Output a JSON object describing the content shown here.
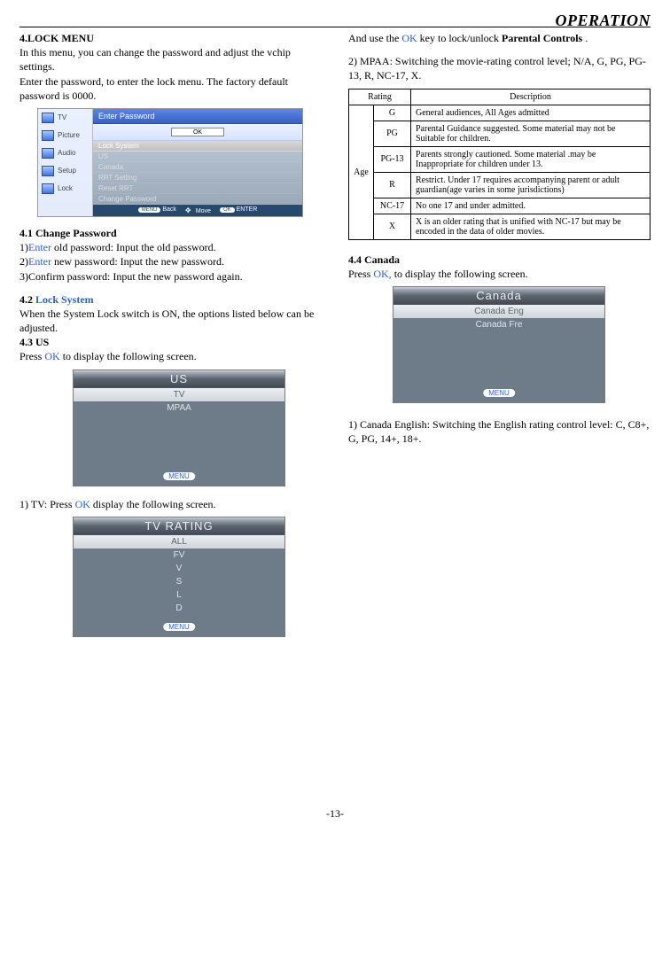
{
  "header": {
    "title": "OPERATION"
  },
  "left": {
    "s4_title": "4.LOCK MENU",
    "s4_p1": "In this menu, you can change the password and adjust the vchip settings.",
    "s4_p2": "Enter the password, to enter the lock menu. The factory default password is 0000.",
    "lockbox": {
      "side": [
        "TV",
        "Picture",
        "Audio",
        "Setup",
        "Lock"
      ],
      "top": "Enter Password",
      "ok": "OK",
      "rows": [
        "Lock System",
        "US",
        "Canada",
        "RRT Setting",
        "Reset RRT",
        "Change Password"
      ],
      "foot_menu": "MENU",
      "foot_back": "Back",
      "foot_move": "Move",
      "foot_ok": "OK",
      "foot_enter": "ENTER"
    },
    "s41_title": "4.1 Change Password",
    "s41_1a": "1)",
    "s41_1b": "Enter",
    "s41_1c": " old password: Input the old password.",
    "s41_2a": "2)",
    "s41_2b": "Enter",
    "s41_2c": " new password: Input the new password.",
    "s41_3": "3)Confirm password: Input the new password again.",
    "s42_title_a": "4.2 ",
    "s42_title_b": "Lock System",
    "s42_p": "When the System Lock switch is ON, the options listed below can be adjusted.",
    "s43_title": "4.3 US",
    "s43_a": "Press ",
    "s43_b": "OK",
    "s43_c": " to display the following screen.",
    "us_panel": {
      "title": "US",
      "row1": "TV",
      "row2": "MPAA",
      "menu": "MENU"
    },
    "s43_tv_a": "1) TV: Press ",
    "s43_tv_b": "OK",
    "s43_tv_c": " display the following screen.",
    "tvrating_panel": {
      "title": "TV RATING",
      "rows": [
        "ALL",
        "FV",
        "V",
        "S",
        "L",
        "D"
      ],
      "menu": "MENU"
    }
  },
  "right": {
    "intro_a": "And use the ",
    "intro_b": "OK",
    "intro_c": " key to lock/unlock ",
    "intro_d": "Parental Controls",
    "intro_e": " .",
    "mpaa": "2) MPAA: Switching the movie-rating control level; N/A, G, PG, PG-13, R, NC-17, X.",
    "tbl": {
      "h1": "Rating",
      "h2": "Description",
      "age": "Age",
      "rows": [
        {
          "code": "G",
          "desc": "General audiences, All Ages admitted"
        },
        {
          "code": "PG",
          "desc": "Parental Guidance suggested. Some material may not be Suitable for children."
        },
        {
          "code": "PG-13",
          "desc": "Parents strongly cautioned. Some material .may be Inappropriate for children under 13."
        },
        {
          "code": "R",
          "desc": "Restrict. Under 17 requires accompanying parent or adult guardian(age varies in some jurisdictions)"
        },
        {
          "code": "NC-17",
          "desc": "No one 17 and under admitted."
        },
        {
          "code": "X",
          "desc": "X is an older rating that is unified with NC-17 but may be encoded in the data of older movies."
        }
      ]
    },
    "s44_title": "4.4 Canada",
    "s44_a": "Press ",
    "s44_b": "OK,",
    "s44_c": " to display the following screen.",
    "canada_panel": {
      "title": "Canada",
      "row1": "Canada Eng",
      "row2": "Canada Fre",
      "menu": "MENU"
    },
    "s44_eng": "1) Canada English: Switching the English rating control level: C, C8+, G, PG, 14+, 18+."
  },
  "footer": {
    "page": "-13-"
  }
}
